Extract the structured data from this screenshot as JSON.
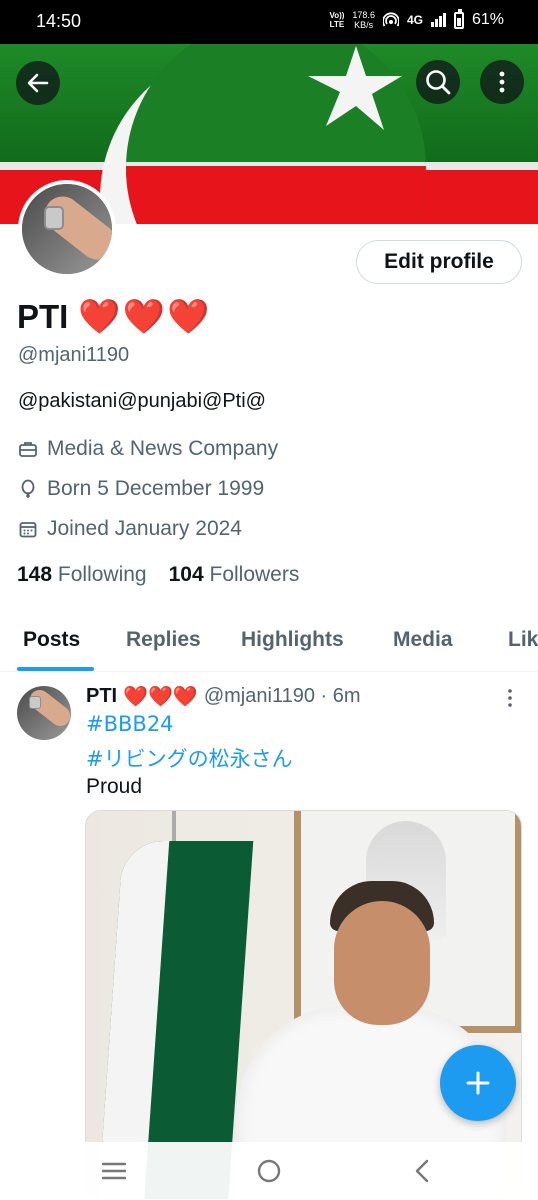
{
  "status_bar": {
    "time": "14:50",
    "volte_top": "Vo))",
    "volte_bottom": "LTE",
    "speed_value": "178.6",
    "speed_unit": "KB/s",
    "network": "4G",
    "battery": "61%"
  },
  "profile": {
    "name": "PTI",
    "name_emoji": "❤️❤️❤️",
    "handle": "@mjani1190",
    "bio": "@pakistani@punjabi@Pti@",
    "category": "Media & News Company",
    "born": "Born 5 December 1999",
    "joined": "Joined January 2024",
    "following_count": "148",
    "following_label": "Following",
    "followers_count": "104",
    "followers_label": "Followers",
    "edit_label": "Edit profile"
  },
  "tabs": [
    {
      "label": "Posts",
      "active": true
    },
    {
      "label": "Replies",
      "active": false
    },
    {
      "label": "Highlights",
      "active": false
    },
    {
      "label": "Media",
      "active": false
    },
    {
      "label": "Lik",
      "active": false
    }
  ],
  "post": {
    "name": "PTI",
    "name_emoji": "❤️❤️❤️",
    "handle_time": "@mjani1190 · 6m",
    "hashtags": [
      "#BBB24",
      "#リビングの松永さん"
    ],
    "text": "Proud"
  },
  "colors": {
    "accent": "#1d9bf0",
    "text_primary": "#0f1419",
    "text_secondary": "#536471",
    "banner_green": "#1f8a28",
    "banner_red": "#e8141b"
  },
  "icons": {
    "back": "arrow-left",
    "search": "magnifier",
    "more": "vertical-dots",
    "category": "briefcase",
    "born": "balloon",
    "joined": "calendar",
    "compose": "plus",
    "nav_menu": "three-lines",
    "nav_home": "circle",
    "nav_back": "chevron-left"
  }
}
